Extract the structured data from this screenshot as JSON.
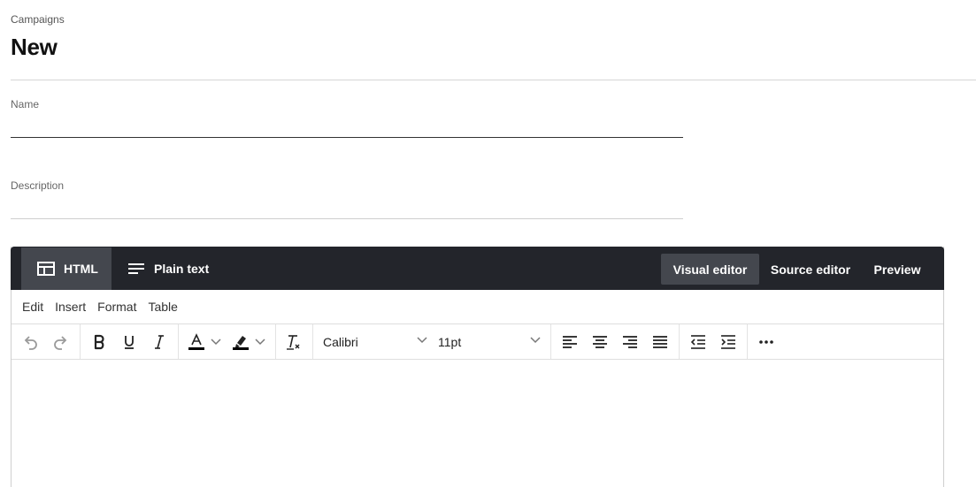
{
  "header": {
    "breadcrumb": "Campaigns",
    "title": "New"
  },
  "form": {
    "name_label": "Name",
    "name_value": "",
    "description_label": "Description",
    "description_value": ""
  },
  "editor": {
    "mode_tabs": [
      {
        "label": "HTML",
        "icon": "layout-icon",
        "active": true
      },
      {
        "label": "Plain text",
        "icon": "text-lines-icon",
        "active": false
      }
    ],
    "view_buttons": [
      {
        "label": "Visual editor",
        "active": true
      },
      {
        "label": "Source editor",
        "active": false
      },
      {
        "label": "Preview",
        "active": false
      }
    ],
    "menu": [
      "Edit",
      "Insert",
      "Format",
      "Table"
    ],
    "toolbar": {
      "font_family": "Calibri",
      "font_size": "11pt"
    },
    "body_text": ""
  },
  "colors": {
    "topbar_bg": "#23252b",
    "active_tab_bg": "#44474e",
    "text_color_swatch": "#000000",
    "highlight_swatch": "#000000"
  }
}
